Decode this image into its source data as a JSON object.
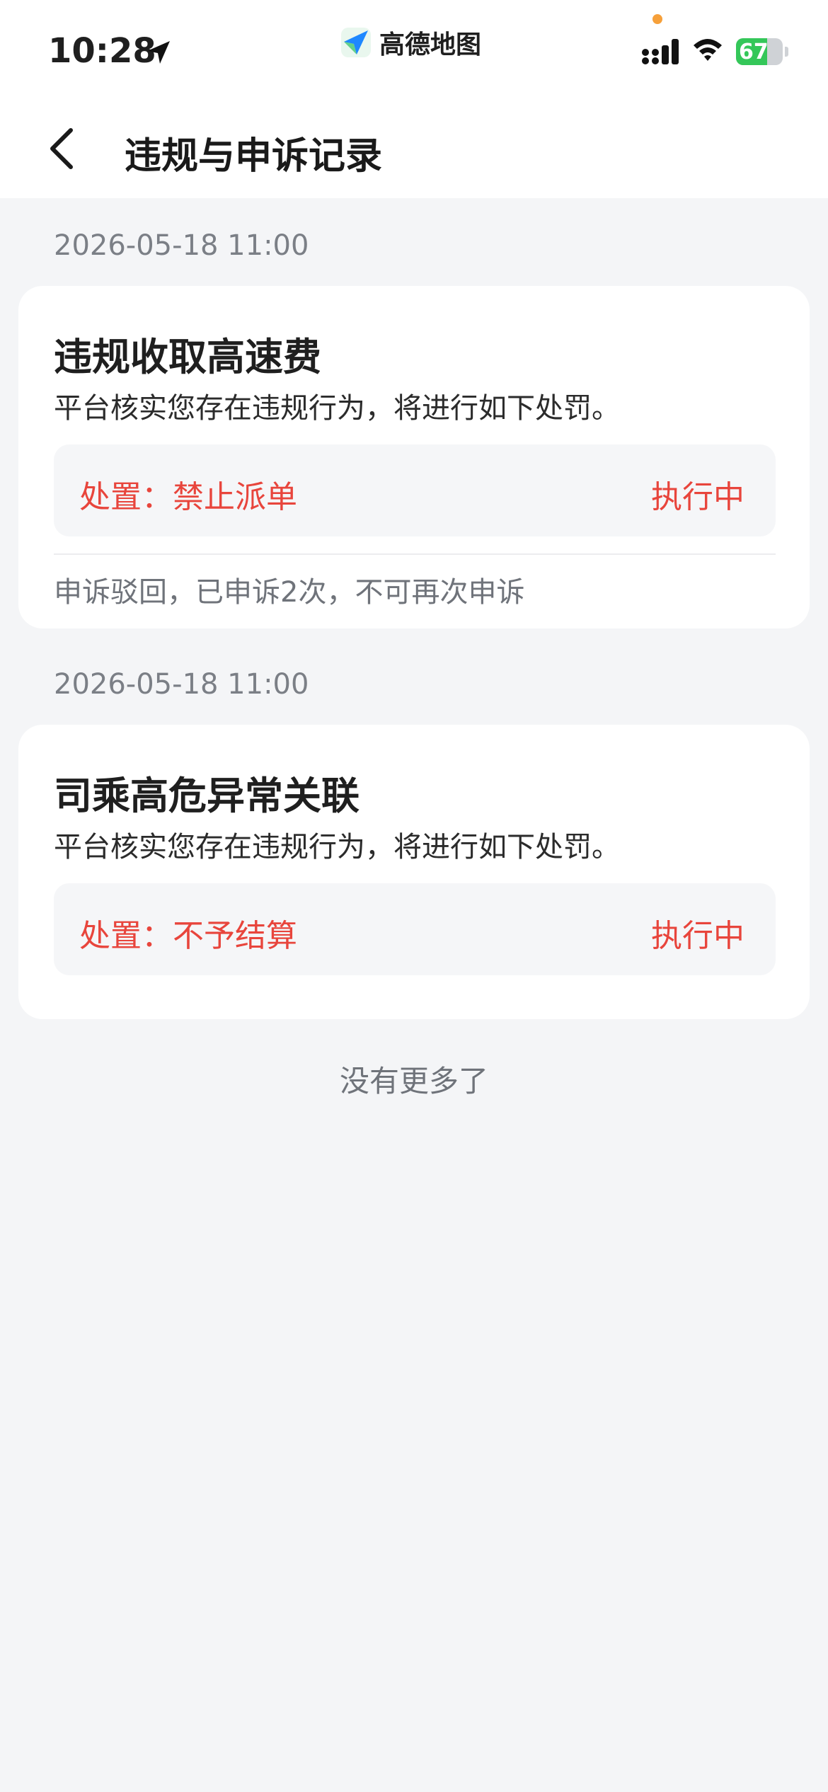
{
  "status_bar": {
    "time": "10:28",
    "app_name": "高德地图",
    "battery_level": 67,
    "battery_text": "67",
    "battery_color": "#34c759",
    "icons": [
      "location-arrow-icon",
      "signal-icon",
      "wifi-icon",
      "battery-icon"
    ]
  },
  "nav": {
    "title": "违规与申诉记录",
    "back_icon": "chevron-left-icon"
  },
  "records": [
    {
      "date": "2026-05-18 11:00",
      "title": "违规收取高速费",
      "description": "平台核实您存在违规行为，将进行如下处罚。",
      "penalty": "处置：禁止派单",
      "status": "执行中",
      "appeal_note": "申诉驳回，已申诉2次，不可再次申诉"
    },
    {
      "date": "2026-05-18 11:00",
      "title": "司乘高危异常关联",
      "description": "平台核实您存在违规行为，将进行如下处罚。",
      "penalty": "处置：不予结算",
      "status": "执行中"
    }
  ],
  "footer": {
    "end_text": "没有更多了"
  },
  "colors": {
    "penalty_red": "#e8453c",
    "background": "#f4f5f7",
    "muted_text": "#7b7f86"
  }
}
